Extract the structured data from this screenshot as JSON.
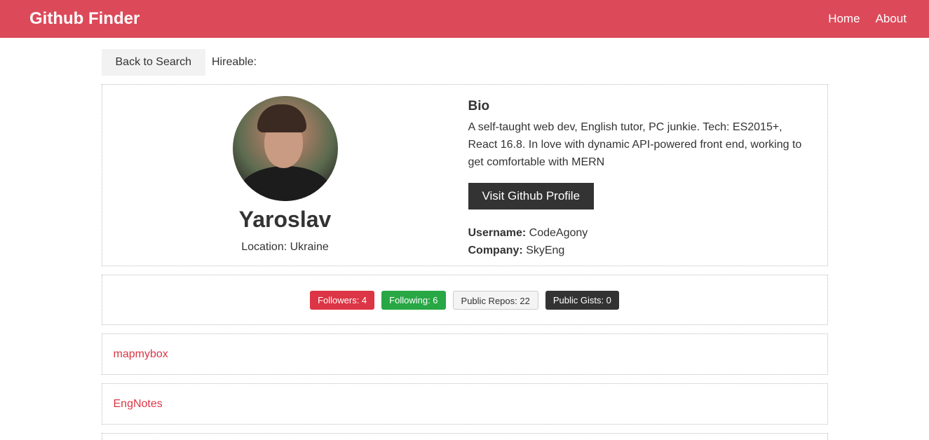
{
  "navbar": {
    "brand": "Github Finder",
    "links": [
      {
        "label": "Home"
      },
      {
        "label": "About"
      }
    ]
  },
  "actions": {
    "back_label": "Back to Search",
    "hireable_label": "Hireable:"
  },
  "profile": {
    "name": "Yaroslav",
    "location": "Location: Ukraine",
    "bio_heading": "Bio",
    "bio": "A self-taught web dev, English tutor, PC junkie. Tech: ES2015+, React 16.8. In love with dynamic API-powered front end, working to get comfortable with MERN",
    "visit_label": "Visit Github Profile",
    "username_label": "Username:",
    "username": "CodeAgony",
    "company_label": "Company:",
    "company": "SkyEng"
  },
  "stats": {
    "followers": "Followers: 4",
    "following": "Following: 6",
    "repos": "Public Repos: 22",
    "gists": "Public Gists: 0"
  },
  "repos": [
    {
      "name": "mapmybox"
    },
    {
      "name": "EngNotes"
    }
  ],
  "colors": {
    "navbar": "#dc4a5a",
    "primary": "#dc3545",
    "success": "#28a745",
    "dark": "#333333",
    "light": "#f4f4f4"
  }
}
